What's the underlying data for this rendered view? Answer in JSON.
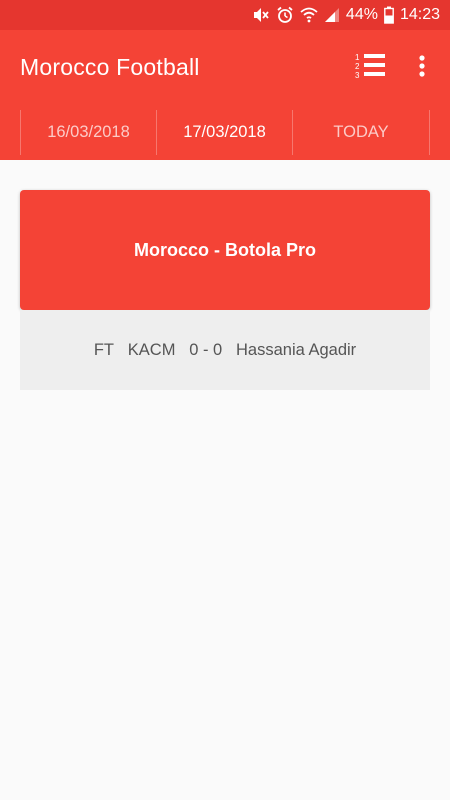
{
  "status_bar": {
    "battery_percent": "44%",
    "time": "14:23",
    "icons": [
      "mute-icon",
      "alarm-icon",
      "wifi-icon",
      "signal-icon",
      "battery-icon"
    ]
  },
  "app_bar": {
    "title": "Morocco Football",
    "actions": [
      "standings-list-icon",
      "more-vert-icon"
    ]
  },
  "tabs": [
    {
      "label": "16/03/2018",
      "selected": false
    },
    {
      "label": "17/03/2018",
      "selected": true
    },
    {
      "label": "TODAY",
      "selected": false
    }
  ],
  "leagues": [
    {
      "name": "Morocco - Botola Pro",
      "matches": [
        {
          "status": "FT",
          "home": "KACM",
          "score": "0 - 0",
          "away": "Hassania Agadir"
        }
      ]
    }
  ],
  "colors": {
    "primary": "#f44336",
    "primary_dark": "#e5362f",
    "match_background": "#eeeeee",
    "page_background": "#fafafa"
  }
}
